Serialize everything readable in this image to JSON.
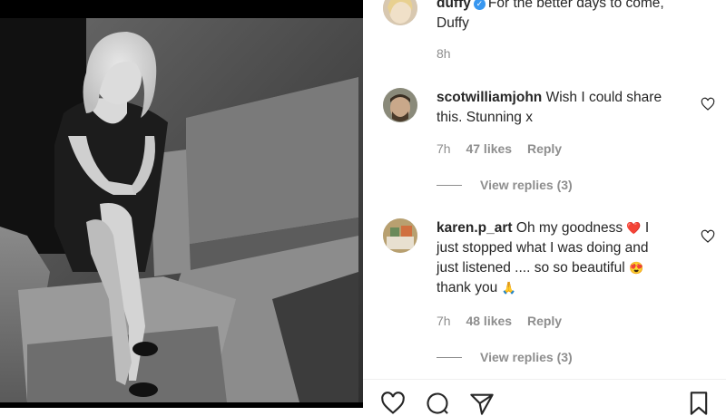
{
  "post": {
    "author": "duffy",
    "caption_line1": "For the better days to come,",
    "caption_line2": "Duffy",
    "time": "8h"
  },
  "comments": [
    {
      "username": "scotwilliamjohn",
      "text_line1": "Wish I could share",
      "text_line2": "this. Stunning x",
      "time": "7h",
      "likes": "47 likes",
      "reply": "Reply",
      "view_replies": "View replies (3)"
    },
    {
      "username": "karen.p_art",
      "text_line1": "Oh my goodness",
      "emoji1": "❤️",
      "text_line1b": "I",
      "text_line2": "just stopped what I was doing and",
      "text_line3": "just listened .... so so beautiful",
      "emoji2": "😍",
      "text_line4": "thank you",
      "emoji3": "🙏",
      "time": "7h",
      "likes": "48 likes",
      "reply": "Reply",
      "view_replies": "View replies (3)"
    }
  ],
  "icons": [
    "heart-icon",
    "comment-icon",
    "share-icon",
    "bookmark-icon"
  ],
  "colors": {
    "text": "#262626",
    "muted": "#8e8e8e",
    "verified": "#3897f0",
    "heart_emoji": "#ed1c24"
  }
}
